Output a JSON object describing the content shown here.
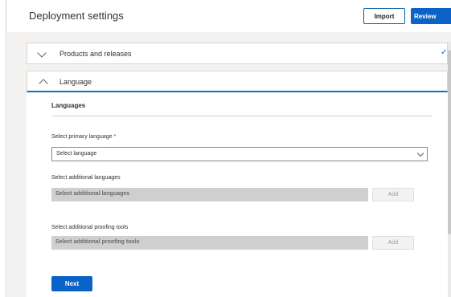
{
  "header": {
    "title": "Deployment settings",
    "import_label": "Import",
    "review_label": "Review"
  },
  "accordion": {
    "products": {
      "label": "Products and releases",
      "completed_icon": "checkmark-icon"
    },
    "language": {
      "label": "Language"
    }
  },
  "language_panel": {
    "section_title": "Languages",
    "primary": {
      "label": "Select primary language",
      "required_marker": "*",
      "placeholder": "Select language"
    },
    "additional": {
      "label": "Select additional languages",
      "placeholder": "Select additional languages",
      "add_label": "Add"
    },
    "proofing": {
      "label": "Select additional proofing tools",
      "placeholder": "Select additional proofing tools",
      "add_label": "Add"
    },
    "next_label": "Next"
  },
  "colors": {
    "accent": "#0b63c7",
    "canvas": "#f3f2f1",
    "disabled_field": "#cfcfcf"
  }
}
